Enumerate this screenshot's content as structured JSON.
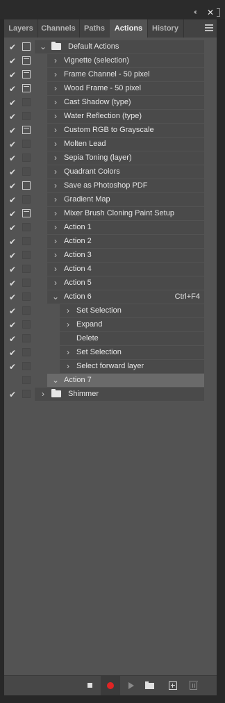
{
  "tabs": [
    {
      "label": "Layers",
      "active": false
    },
    {
      "label": "Channels",
      "active": false
    },
    {
      "label": "Paths",
      "active": false
    },
    {
      "label": "Actions",
      "active": true
    },
    {
      "label": "History",
      "active": false
    }
  ],
  "window_controls": {
    "collapse": "‹‹",
    "close": "✕"
  },
  "check_glyph": "✔",
  "actions": [
    {
      "label": "Default Actions",
      "level": 0,
      "type": "set",
      "expanded": true,
      "check": true,
      "dialog": "on-plain"
    },
    {
      "label": "Vignette (selection)",
      "level": 1,
      "type": "action",
      "expanded": false,
      "check": true,
      "dialog": "on"
    },
    {
      "label": "Frame Channel - 50 pixel",
      "level": 1,
      "type": "action",
      "expanded": false,
      "check": true,
      "dialog": "on"
    },
    {
      "label": "Wood Frame - 50 pixel",
      "level": 1,
      "type": "action",
      "expanded": false,
      "check": true,
      "dialog": "on"
    },
    {
      "label": "Cast Shadow (type)",
      "level": 1,
      "type": "action",
      "expanded": false,
      "check": true,
      "dialog": "off"
    },
    {
      "label": "Water Reflection (type)",
      "level": 1,
      "type": "action",
      "expanded": false,
      "check": true,
      "dialog": "off"
    },
    {
      "label": "Custom RGB to Grayscale",
      "level": 1,
      "type": "action",
      "expanded": false,
      "check": true,
      "dialog": "on"
    },
    {
      "label": "Molten Lead",
      "level": 1,
      "type": "action",
      "expanded": false,
      "check": true,
      "dialog": "off"
    },
    {
      "label": "Sepia Toning (layer)",
      "level": 1,
      "type": "action",
      "expanded": false,
      "check": true,
      "dialog": "off"
    },
    {
      "label": "Quadrant Colors",
      "level": 1,
      "type": "action",
      "expanded": false,
      "check": true,
      "dialog": "off"
    },
    {
      "label": "Save as Photoshop PDF",
      "level": 1,
      "type": "action",
      "expanded": false,
      "check": true,
      "dialog": "on-plain"
    },
    {
      "label": "Gradient Map",
      "level": 1,
      "type": "action",
      "expanded": false,
      "check": true,
      "dialog": "off"
    },
    {
      "label": "Mixer Brush Cloning Paint Setup",
      "level": 1,
      "type": "action",
      "expanded": false,
      "check": true,
      "dialog": "on"
    },
    {
      "label": "Action 1",
      "level": 1,
      "type": "action",
      "expanded": false,
      "check": true,
      "dialog": "off"
    },
    {
      "label": "Action 2",
      "level": 1,
      "type": "action",
      "expanded": false,
      "check": true,
      "dialog": "off"
    },
    {
      "label": "Action 3",
      "level": 1,
      "type": "action",
      "expanded": false,
      "check": true,
      "dialog": "off"
    },
    {
      "label": "Action 4",
      "level": 1,
      "type": "action",
      "expanded": false,
      "check": true,
      "dialog": "off"
    },
    {
      "label": "Action 5",
      "level": 1,
      "type": "action",
      "expanded": false,
      "check": true,
      "dialog": "off"
    },
    {
      "label": "Action 6",
      "level": 1,
      "type": "action",
      "expanded": true,
      "check": true,
      "dialog": "off",
      "shortcut": "Ctrl+F4"
    },
    {
      "label": "Set Selection",
      "level": 2,
      "type": "step",
      "expandable": true,
      "check": true,
      "dialog": "off"
    },
    {
      "label": "Expand",
      "level": 2,
      "type": "step",
      "expandable": true,
      "check": true,
      "dialog": "off"
    },
    {
      "label": "Delete",
      "level": 2,
      "type": "step",
      "expandable": false,
      "check": true,
      "dialog": "off"
    },
    {
      "label": "Set Selection",
      "level": 2,
      "type": "step",
      "expandable": true,
      "check": true,
      "dialog": "off"
    },
    {
      "label": "Select forward layer",
      "level": 2,
      "type": "step",
      "expandable": true,
      "check": true,
      "dialog": "off"
    },
    {
      "label": "Action 7",
      "level": 1,
      "type": "action",
      "expanded": true,
      "check": false,
      "dialog": "off",
      "selected": true
    },
    {
      "label": "Shimmer",
      "level": 0,
      "type": "set",
      "expanded": false,
      "check": true,
      "dialog": "off"
    }
  ],
  "footer_buttons": [
    {
      "name": "stop-recording-button",
      "icon": "stop-icon"
    },
    {
      "name": "record-button",
      "icon": "record-icon",
      "color": "#e02424"
    },
    {
      "name": "play-selection-button",
      "icon": "play-icon"
    },
    {
      "name": "create-new-set-button",
      "icon": "folder-icon"
    },
    {
      "name": "create-new-action-button",
      "icon": "new-item-icon"
    },
    {
      "name": "delete-button",
      "icon": "trash-icon"
    }
  ]
}
